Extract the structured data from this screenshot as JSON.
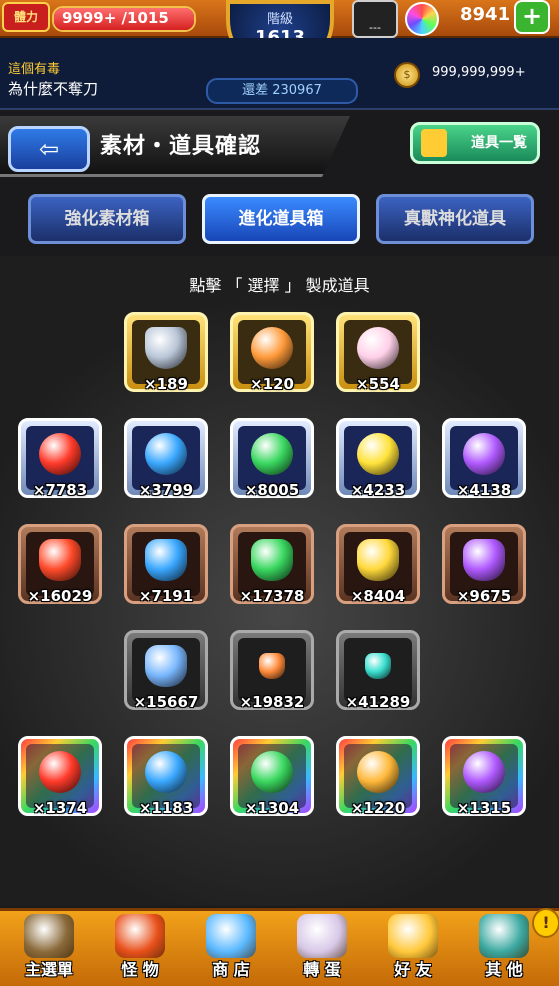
{
  "status": {
    "stamina_label": "體力",
    "stamina_value": "9999+ /1015",
    "stamina_fraction": 1.0,
    "rank_label": "階級",
    "rank_value": "1613",
    "gem_button_label": "---",
    "orb_count": "8941",
    "plus_label": "+"
  },
  "info": {
    "news_title": "這個有毒",
    "news_text": "為什麼不奪刀",
    "next_rank_text": "還差 230967",
    "coin_value": "999,999,999+"
  },
  "header": {
    "back_label": "⇦",
    "title": "素材・道具確認",
    "item_list_label": "道具一覧"
  },
  "tabs": [
    {
      "label": "強化素材箱",
      "active": false
    },
    {
      "label": "進化道具箱",
      "active": true
    },
    {
      "label": "真獸神化道具",
      "active": false
    }
  ],
  "instruction": "點擊 「 選擇 」 製成道具",
  "items": [
    {
      "icon": "shield-badge",
      "frame": "gold",
      "color": "#b9c6d8",
      "count": "×189"
    },
    {
      "icon": "rainbow-hook",
      "frame": "gold",
      "color": "#ff9a3a",
      "count": "×120"
    },
    {
      "icon": "pearl-orb",
      "frame": "gold",
      "color": "#ffd0e8",
      "count": "×554"
    },
    {
      "icon": "fire-orb",
      "frame": "silver",
      "color": "#ff3a2a",
      "count": "×7783"
    },
    {
      "icon": "water-orb",
      "frame": "silver",
      "color": "#3aa8ff",
      "count": "×3799"
    },
    {
      "icon": "wood-orb",
      "frame": "silver",
      "color": "#3ad860",
      "count": "×8005"
    },
    {
      "icon": "light-orb",
      "frame": "silver",
      "color": "#ffe23a",
      "count": "×4233"
    },
    {
      "icon": "dark-orb",
      "frame": "silver",
      "color": "#b05aff",
      "count": "×4138"
    },
    {
      "icon": "fire-crystal",
      "frame": "bronze",
      "color": "#ff4a2a",
      "count": "×16029"
    },
    {
      "icon": "water-crystal",
      "frame": "bronze",
      "color": "#3aa8ff",
      "count": "×7191"
    },
    {
      "icon": "wood-crystal",
      "frame": "bronze",
      "color": "#3ad860",
      "count": "×17378"
    },
    {
      "icon": "light-crystal",
      "frame": "bronze",
      "color": "#ffd83a",
      "count": "×8404"
    },
    {
      "icon": "dark-crystal",
      "frame": "bronze",
      "color": "#b05aff",
      "count": "×9675"
    },
    {
      "icon": "prism-crystal",
      "frame": "dark",
      "color": "#7ab8ff",
      "count": "×15667"
    },
    {
      "icon": "amber-stone",
      "frame": "dark",
      "color": "#ff8a3a",
      "count": "×19832"
    },
    {
      "icon": "teal-shard",
      "frame": "dark",
      "color": "#3ae0d0",
      "count": "×41289"
    },
    {
      "icon": "fire-dragon-orb",
      "frame": "rainbow",
      "color": "#ff3a2a",
      "count": "×1374"
    },
    {
      "icon": "water-dragon-orb",
      "frame": "rainbow",
      "color": "#3aa8ff",
      "count": "×1183"
    },
    {
      "icon": "wood-dragon-orb",
      "frame": "rainbow",
      "color": "#3ad860",
      "count": "×1304"
    },
    {
      "icon": "light-dragon-orb",
      "frame": "rainbow",
      "color": "#ffb83a",
      "count": "×1220"
    },
    {
      "icon": "dark-dragon-orb",
      "frame": "rainbow",
      "color": "#b05aff",
      "count": "×1315"
    }
  ],
  "nav": [
    {
      "icon": "castle-gate-icon",
      "label": "主選單",
      "color": "#8a6a3a"
    },
    {
      "icon": "monster-icon",
      "label": "怪 物",
      "color": "#e8501a"
    },
    {
      "icon": "rainbow-orb-icon",
      "label": "商 店",
      "color": "#5ab8ff"
    },
    {
      "icon": "egg-character-icon",
      "label": "轉 蛋",
      "color": "#d8c8e8"
    },
    {
      "icon": "friends-balloon-icon",
      "label": "好 友",
      "color": "#ffc83a"
    },
    {
      "icon": "settings-icon",
      "label": "其 他",
      "color": "#3aa8a0"
    }
  ],
  "alert_label": "!"
}
